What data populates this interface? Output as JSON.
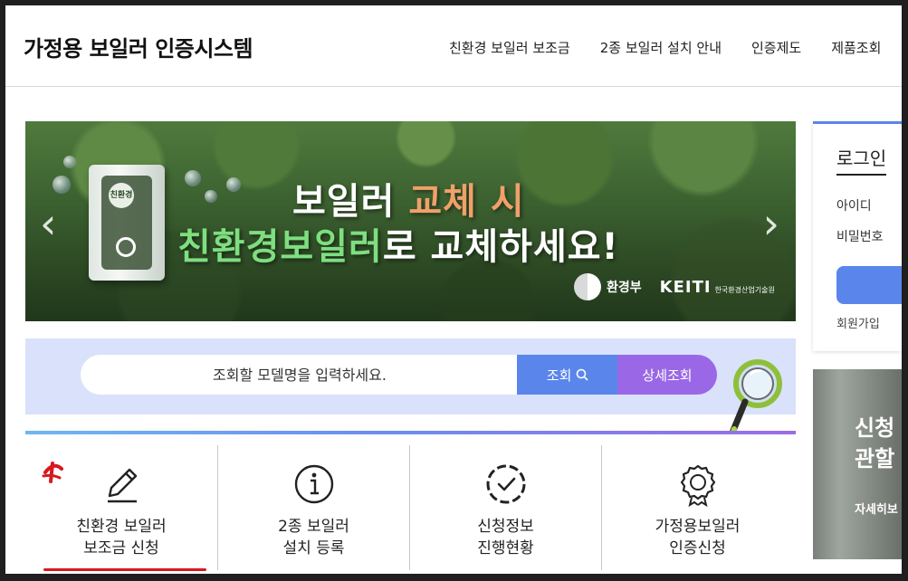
{
  "header": {
    "site_title": "가정용 보일러 인증시스템",
    "nav": [
      "친환경 보일러 보조금",
      "2종 보일러 설치 안내",
      "인증제도",
      "제품조회"
    ]
  },
  "banner": {
    "line1_white": "보일러 ",
    "line1_accent": "교체 시",
    "line2_accent": "친환경보일러",
    "line2_white": "로 교체하세요!",
    "org1": "환경부",
    "org2": "KEITI",
    "org2_sub": "한국환경산업기술원",
    "prev_arrow": "‹",
    "next_arrow": "›",
    "boiler_badge": "친환경",
    "colors": {
      "accent_orange": "#f0a06a",
      "accent_green": "#7ede80"
    }
  },
  "search": {
    "placeholder": "조회할 모델명을 입력하세요.",
    "search_label": "조회",
    "detail_label": "상세조회",
    "colors": {
      "search_btn": "#5a86ec",
      "detail_btn": "#9a68e6",
      "area_bg": "#d9e2fa"
    }
  },
  "quick_menu": [
    {
      "label": "친환경 보일러\n보조금 신청",
      "icon": "pencil-icon"
    },
    {
      "label": "2종 보일러\n설치 등록",
      "icon": "info-icon"
    },
    {
      "label": "신청정보\n진행현황",
      "icon": "check-circle-icon"
    },
    {
      "label": "가정용보일러\n인증신청",
      "icon": "award-icon"
    }
  ],
  "login": {
    "title": "로그인",
    "id_label": "아이디",
    "pw_label": "비밀번호",
    "signup": "회원가입"
  },
  "side_card": {
    "title": "신청\n관할",
    "more": "자세히보"
  }
}
